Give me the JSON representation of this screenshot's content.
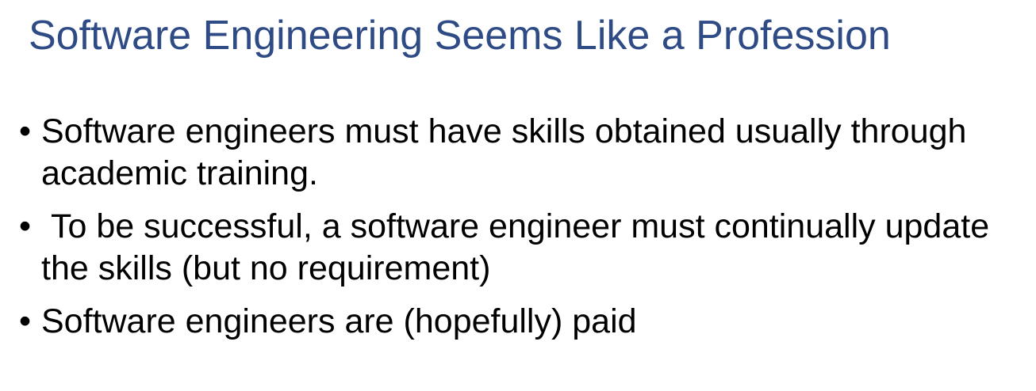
{
  "slide": {
    "title": "Software Engineering Seems Like a Profession",
    "bullet_symbol": "•",
    "bullets": [
      {
        "text": "Software engineers must have skills obtained usually through academic training."
      },
      {
        "text": " To be successful, a software engineer must continually update the skills (but no requirement)"
      },
      {
        "text": "Software engineers are (hopefully) paid"
      }
    ]
  }
}
